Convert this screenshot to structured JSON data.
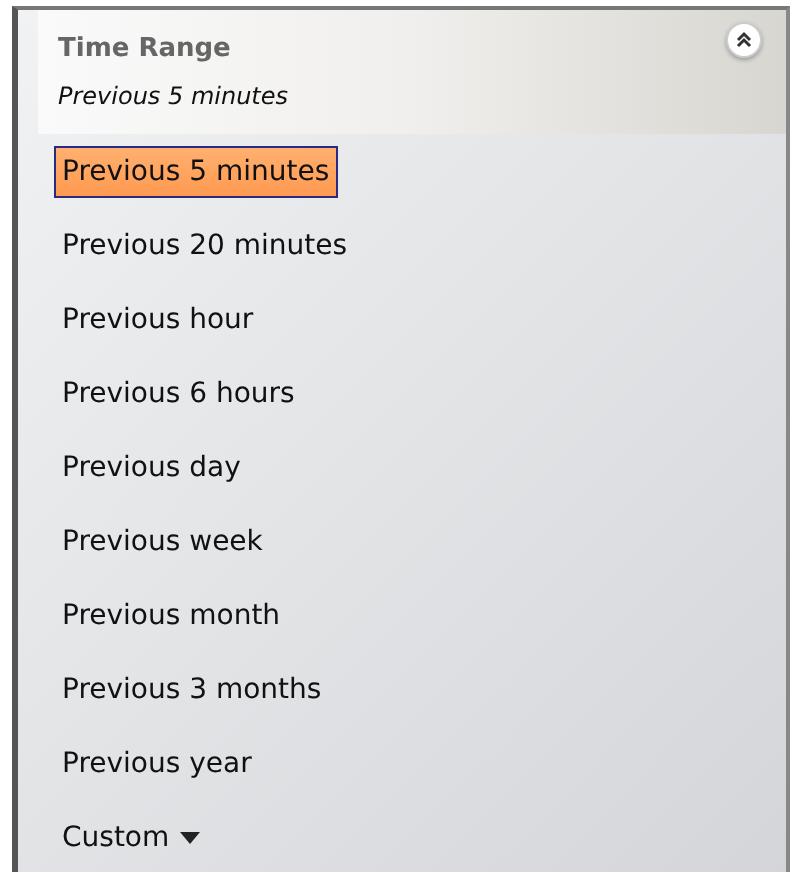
{
  "panel": {
    "title": "Time Range",
    "current": "Previous 5 minutes",
    "expanded": true
  },
  "options": [
    {
      "label": "Previous 5 minutes",
      "selected": true,
      "kind": "option"
    },
    {
      "label": "Previous 20 minutes",
      "selected": false,
      "kind": "option"
    },
    {
      "label": "Previous hour",
      "selected": false,
      "kind": "option"
    },
    {
      "label": "Previous 6 hours",
      "selected": false,
      "kind": "option"
    },
    {
      "label": "Previous day",
      "selected": false,
      "kind": "option"
    },
    {
      "label": "Previous week",
      "selected": false,
      "kind": "option"
    },
    {
      "label": "Previous month",
      "selected": false,
      "kind": "option"
    },
    {
      "label": "Previous 3 months",
      "selected": false,
      "kind": "option"
    },
    {
      "label": "Previous year",
      "selected": false,
      "kind": "option"
    },
    {
      "label": "Custom",
      "selected": false,
      "kind": "dropdown"
    }
  ]
}
